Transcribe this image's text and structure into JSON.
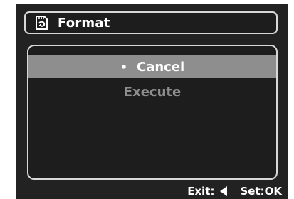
{
  "window": {
    "title": "Format",
    "title_icon": "format-card-icon"
  },
  "menu": {
    "items": [
      {
        "label": "Cancel",
        "selected": true
      },
      {
        "label": "Execute",
        "selected": false
      }
    ],
    "bullet": "•"
  },
  "footer": {
    "exit_label": "Exit:",
    "exit_icon": "left-arrow-icon",
    "set_label": "Set:OK"
  },
  "colors": {
    "background": "#222222",
    "panel": "#1d1d1d",
    "border": "#d8d8d8",
    "selected_bg": "#8e8e8e",
    "unselected_text": "#8e8e8e",
    "text": "#ffffff"
  }
}
